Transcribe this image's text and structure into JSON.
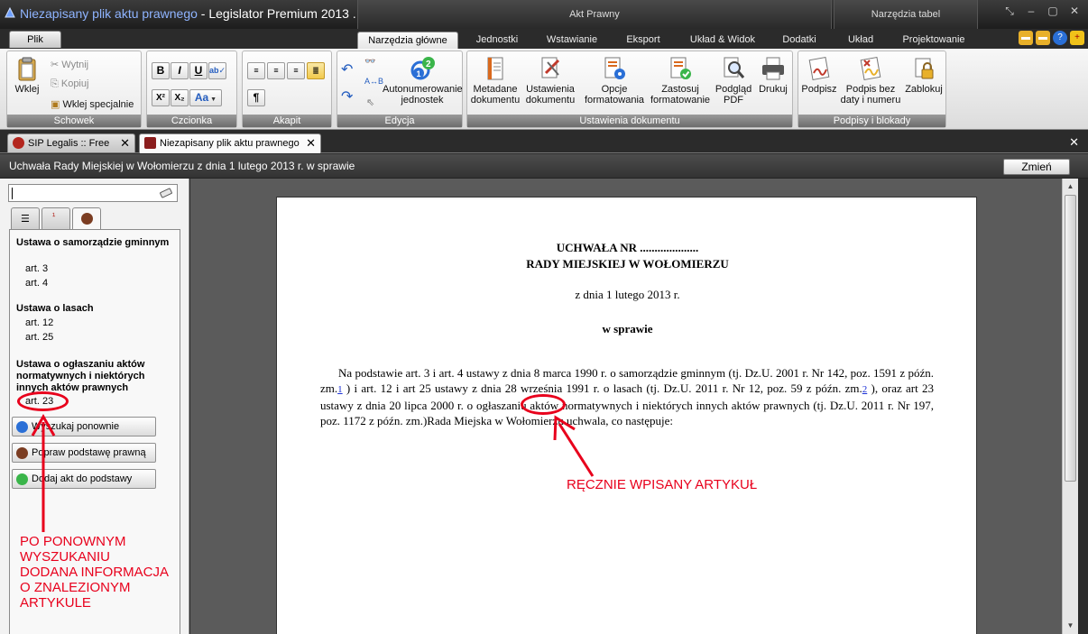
{
  "window": {
    "doc_title": "Niezapisany plik aktu prawnego",
    "app_title": " - Legislator Premium 2013 ...",
    "ctx_group1": "Akt Prawny",
    "ctx_group2": "Narzędzia tabel"
  },
  "menu": {
    "file": "Plik",
    "tabs": [
      "Narzędzia główne",
      "Jednostki",
      "Wstawianie",
      "Eksport",
      "Układ & Widok",
      "Dodatki",
      "Układ",
      "Projektowanie"
    ]
  },
  "ribbon": {
    "schowek": {
      "label": "Schowek",
      "paste": "Wklej",
      "cut": "Wytnij",
      "copy": "Kopiuj",
      "paste_special": "Wklej specjalnie"
    },
    "czcionka": {
      "label": "Czcionka",
      "bold": "B",
      "italic": "I",
      "underline": "U",
      "superscript": "X²",
      "subscript": "X₂",
      "aa": "Aa"
    },
    "akapit": {
      "label": "Akapit",
      "pilcrow": "¶"
    },
    "edycja": {
      "label": "Edycja",
      "autonumber_line1": "Autonumerowanie",
      "autonumber_line2": "jednostek"
    },
    "ustawienia": {
      "label": "Ustawienia dokumentu",
      "metadata_line1": "Metadane",
      "metadata_line2": "dokumentu",
      "settings_line1": "Ustawienia",
      "settings_line2": "dokumentu",
      "opcje_line1": "Opcje",
      "opcje_line2": "formatowania",
      "zastosuj_line1": "Zastosuj",
      "zastosuj_line2": "formatowanie",
      "podglad_line1": "Podgląd",
      "podglad_line2": "PDF",
      "drukuj": "Drukuj"
    },
    "podpisy": {
      "label": "Podpisy i blokady",
      "podpisz": "Podpisz",
      "bezdaty_line1": "Podpis bez",
      "bezdaty_line2": "daty i numeru",
      "zablokuj": "Zablokuj"
    }
  },
  "doc_tabs": [
    "SIP Legalis :: Free",
    "Niezapisany plik aktu prawnego"
  ],
  "header": {
    "title": "Uchwała Rady Miejskiej w Wołomierzu z dnia 1 lutego 2013 r. w sprawie",
    "change_button": "Zmień"
  },
  "left_panel": {
    "acts": [
      {
        "title": "Ustawa o samorządzie gminnym",
        "articles": [
          "art. 3",
          "art. 4"
        ]
      },
      {
        "title": "Ustawa o lasach",
        "articles": [
          "art. 12",
          "art. 25"
        ]
      },
      {
        "title": "Ustawa o ogłaszaniu aktów normatywnych i niektórych innych aktów prawnych",
        "articles": [
          "art. 23"
        ]
      }
    ],
    "buttons": [
      "Wyszukaj ponownie",
      "Popraw podstawę prawną",
      "Dodaj akt do podstawy"
    ]
  },
  "document": {
    "line1": "UCHWAŁA NR ....................",
    "line2": "RADY MIEJSKIEJ W WOŁOMIERZU",
    "date": "z dnia 1 lutego 2013 r.",
    "subject": "w sprawie",
    "p_a": "Na podstawie art. 3 i art. 4 ustawy z dnia 8 marca 1990 r. o samorządzie gminnym (tj. Dz.U. 2001 r. Nr 142, poz. 1591 z późn. zm.",
    "fn1": "1",
    "p_b": " ) i art. 12 i art 25 ustawy z dnia 28 września 1991 r. o lasach (tj. Dz.U. 2011 r. Nr 12, poz. 59 z późn. zm.",
    "fn2": "2",
    "p_c": " ), oraz ",
    "p_art": "art 23",
    "p_d": " ustawy z dnia 20 lipca 2000 r. o ogłaszaniu aktów normatywnych i niektórych innych aktów prawnych (tj. Dz.U. 2011 r. Nr 197, poz. 1172 z późn. zm.)Rada Miejska w Wołomierzu uchwala, co następuje:"
  },
  "annotations": {
    "manual": "RĘCZNIE WPISANY ARTYKUŁ",
    "left_1": "PO PONOWNYM",
    "left_2": "WYSZUKANIU",
    "left_3": "DODANA INFORMACJA",
    "left_4": "O ZNALEZIONYM",
    "left_5": "ARTYKULE",
    "color": "#e8001c"
  }
}
